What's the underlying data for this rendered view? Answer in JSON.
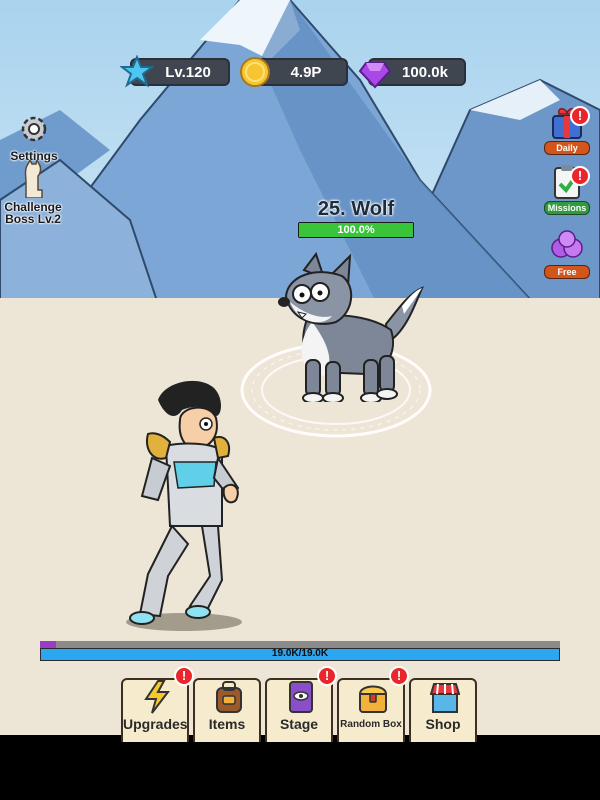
{
  "hud": {
    "level": "Lv.120",
    "gold": "4.9P",
    "gems": "100.0k"
  },
  "left_buttons": {
    "settings": "Settings",
    "challenge_boss": "Challenge Boss Lv.2"
  },
  "right_buttons": {
    "daily": "Daily",
    "missions": "Missions",
    "free": "Free"
  },
  "enemy": {
    "name": "25. Wolf",
    "hp_text": "100.0%",
    "hp_fraction": 1.0
  },
  "player": {
    "hp_text": "19.0K/19.0K",
    "hp_fraction": 1.0,
    "xp_fraction": 0.03
  },
  "tabs": [
    {
      "label": "Upgrades",
      "badge": "!"
    },
    {
      "label": "Items",
      "badge": ""
    },
    {
      "label": "Stage",
      "badge": "!"
    },
    {
      "label": "Random Box",
      "badge": "!"
    },
    {
      "label": "Shop",
      "badge": ""
    }
  ],
  "colors": {
    "hp_green": "#39c43a",
    "hp_blue": "#2ba6f0",
    "xp_purple": "#9a3cc8",
    "badge_red": "#e8262b"
  }
}
